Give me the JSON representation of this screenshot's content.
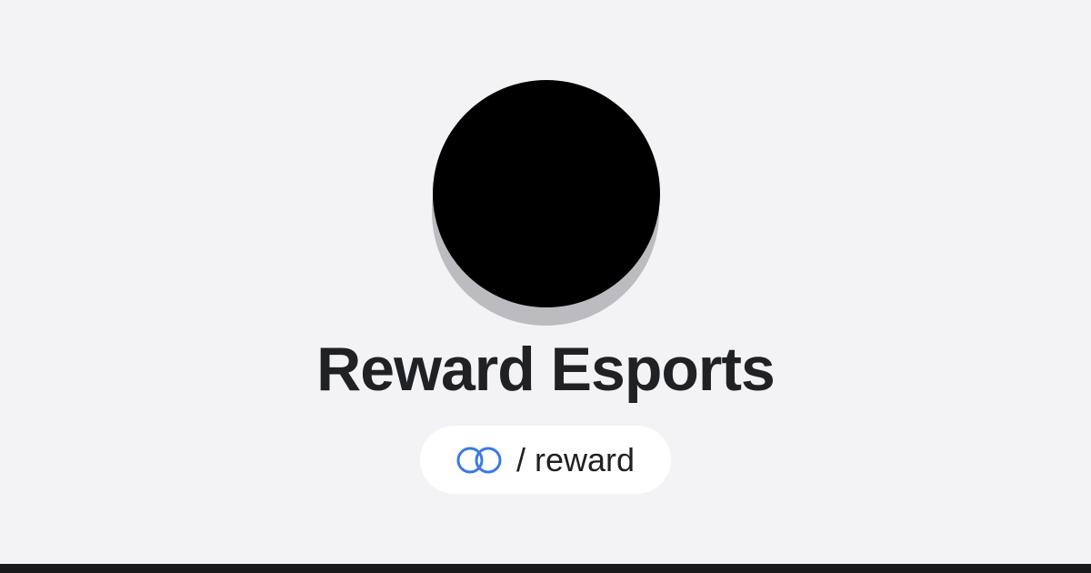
{
  "profile": {
    "name": "Reward Esports",
    "handle": "/ reward"
  },
  "icons": {
    "avatar": "avatar-image",
    "link": "interlocking-rings-icon"
  },
  "colors": {
    "background": "#f3f3f6",
    "avatar": "#000000",
    "avatar_shadow": "#bcbcc0",
    "title_text": "#202124",
    "pill_background": "#ffffff",
    "link_icon": "#3a7be0",
    "bottom_bar": "#18191b"
  }
}
